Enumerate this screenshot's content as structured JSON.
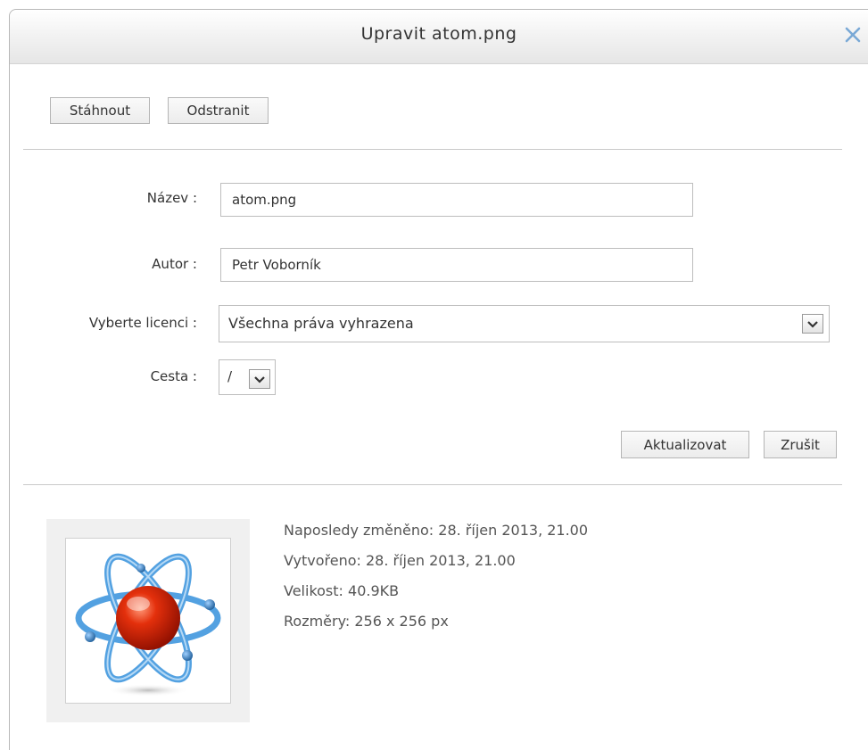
{
  "dialog": {
    "title": "Upravit atom.png"
  },
  "toolbar": {
    "download_label": "Stáhnout",
    "delete_label": "Odstranit"
  },
  "form": {
    "name_label": "Název :",
    "name_value": "atom.png",
    "author_label": "Autor :",
    "author_value": "Petr Voborník",
    "license_label": "Vyberte licenci :",
    "license_value": "Všechna práva vyhrazena",
    "path_label": "Cesta :",
    "path_value": "/"
  },
  "actions": {
    "update_label": "Aktualizovat",
    "cancel_label": "Zrušit"
  },
  "file_info": {
    "modified": "Naposledy změněno: 28. říjen 2013, 21.00",
    "created": "Vytvořeno: 28. říjen 2013, 21.00",
    "size": "Velikost: 40.9KB",
    "dimensions": "Rozměry: 256 x 256 px"
  },
  "icons": {
    "close": "close-icon",
    "dropdown": "chevron-down-icon",
    "preview": "atom-image"
  },
  "colors": {
    "close_icon": "#7aa9d6",
    "atom_orbit": "#4a9de0",
    "atom_nucleus": "#cc1a00"
  }
}
